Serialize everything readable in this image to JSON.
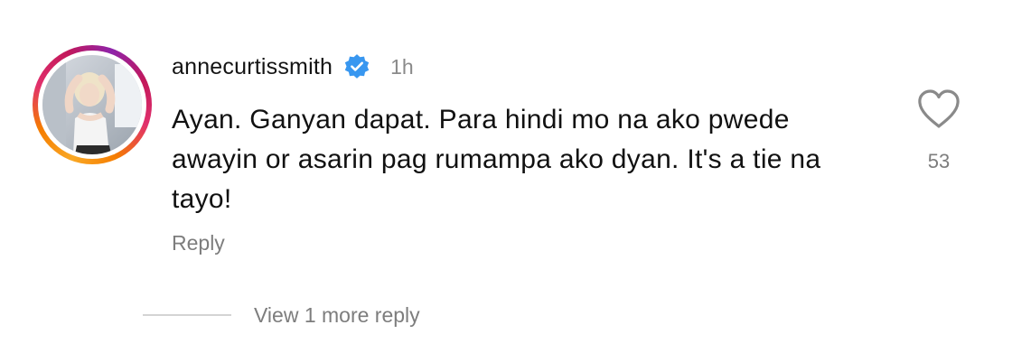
{
  "comment": {
    "username": "annecurtissmith",
    "verified": true,
    "timestamp": "1h",
    "text": "Ayan. Ganyan dapat. Para hindi mo na ako pwede awayin or asarin pag rumampa ako dyan. It's a tie na tayo!",
    "reply_label": "Reply",
    "like_count": "53",
    "view_replies_label": "View 1 more reply"
  },
  "icons": {
    "verified": "verified-badge-icon",
    "like": "heart-outline-icon"
  },
  "colors": {
    "verified_blue": "#3897f0",
    "muted_text": "#7d7d7d",
    "story_ring_start": "#f9a825",
    "story_ring_end": "#c2185b"
  }
}
